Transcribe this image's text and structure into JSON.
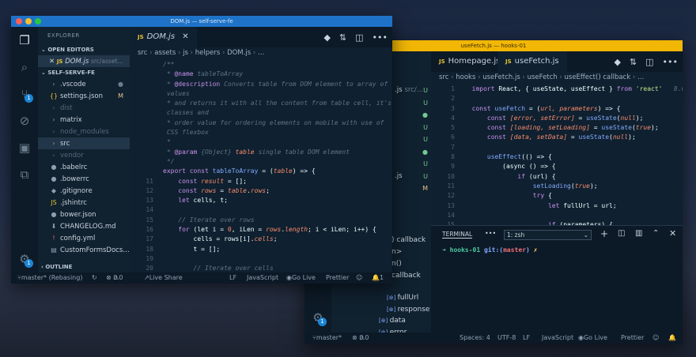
{
  "window_front": {
    "title": "DOM.js — self-serve-fe",
    "explorer_title": "EXPLORER",
    "open_editors_label": "OPEN EDITORS",
    "open_editor_file": "DOM.js",
    "open_editor_path": "src/asset…",
    "project_label": "SELF-SERVE-FE",
    "outline_label": "OUTLINE",
    "files": [
      {
        "name": ".vscode",
        "icon": "›",
        "status": "●",
        "color": "#c8d3dd"
      },
      {
        "name": "settings.json",
        "icon": "{}",
        "status": "M",
        "color": "#c8d3dd"
      },
      {
        "name": "dist",
        "icon": "›",
        "status": "",
        "color": "dim"
      },
      {
        "name": "matrix",
        "icon": "›",
        "status": "",
        "color": "#c8d3dd"
      },
      {
        "name": "node_modules",
        "icon": "›",
        "status": "",
        "color": "dim"
      },
      {
        "name": "src",
        "icon": "›",
        "status": "",
        "color": "#c8d3dd"
      },
      {
        "name": "vendor",
        "icon": "›",
        "status": "",
        "color": "dim"
      },
      {
        "name": ".babelrc",
        "icon": "●",
        "status": "",
        "color": "#c8d3dd"
      },
      {
        "name": ".bowerrc",
        "icon": "●",
        "status": "",
        "color": "#c8d3dd"
      },
      {
        "name": ".gitignore",
        "icon": "◆",
        "status": "",
        "color": "#c8d3dd"
      },
      {
        "name": ".jshintrc",
        "icon": "JS",
        "status": "",
        "color": "#c8d3dd"
      },
      {
        "name": "bower.json",
        "icon": "●",
        "status": "",
        "color": "#c8d3dd"
      },
      {
        "name": "CHANGELOG.md",
        "icon": "⬇",
        "status": "",
        "color": "#c8d3dd"
      },
      {
        "name": "config.yml",
        "icon": "!",
        "status": "",
        "color": "#c8d3dd"
      },
      {
        "name": "CustomFormsDocs…",
        "icon": "▤",
        "status": "",
        "color": "#c8d3dd"
      }
    ],
    "tab_label": "DOM.js",
    "breadcrumb": [
      "src",
      "assets",
      "js",
      "helpers",
      "DOM.js",
      "…"
    ],
    "code_lines": [
      {
        "n": "",
        "t": [
          [
            "/**",
            "c-cm"
          ]
        ]
      },
      {
        "n": "",
        "t": [
          [
            " * ",
            "c-cm"
          ],
          [
            "@name",
            "c-kw"
          ],
          [
            " tableToArray",
            "c-cm"
          ]
        ]
      },
      {
        "n": "",
        "t": [
          [
            " * ",
            "c-cm"
          ],
          [
            "@description",
            "c-kw"
          ],
          [
            " Converts table from DOM element to array of",
            "c-cm"
          ]
        ]
      },
      {
        "n": "",
        "t": [
          [
            " values",
            "c-cm"
          ]
        ]
      },
      {
        "n": "",
        "t": [
          [
            " * and returns it with all the content from table cell, it's",
            "c-cm"
          ]
        ]
      },
      {
        "n": "",
        "t": [
          [
            " classes and",
            "c-cm"
          ]
        ]
      },
      {
        "n": "",
        "t": [
          [
            " * order value for ordering elements on mobile with use of",
            "c-cm"
          ]
        ]
      },
      {
        "n": "",
        "t": [
          [
            " CSS flexbox",
            "c-cm"
          ]
        ]
      },
      {
        "n": "",
        "t": [
          [
            " *",
            "c-cm"
          ]
        ]
      },
      {
        "n": "",
        "t": [
          [
            " * ",
            "c-cm"
          ],
          [
            "@param",
            "c-kw"
          ],
          [
            " {Object} ",
            "c-cm"
          ],
          [
            "table",
            "c-it"
          ],
          [
            " single table DOM element",
            "c-cm"
          ]
        ]
      },
      {
        "n": "",
        "t": [
          [
            " */",
            "c-cm"
          ]
        ]
      },
      {
        "n": "",
        "t": [
          [
            "export const ",
            "c-kw"
          ],
          [
            "tableToArray",
            "c-fn"
          ],
          [
            " = (",
            "c-var"
          ],
          [
            "table",
            "c-it"
          ],
          [
            ") => {",
            "c-var"
          ]
        ]
      },
      {
        "n": "11",
        "t": [
          [
            "    const ",
            "c-kw"
          ],
          [
            "result",
            "c-it"
          ],
          [
            " = [];",
            "c-var"
          ]
        ]
      },
      {
        "n": "12",
        "t": [
          [
            "    const ",
            "c-kw"
          ],
          [
            "rows",
            "c-it"
          ],
          [
            " = ",
            "c-var"
          ],
          [
            "table",
            "c-it"
          ],
          [
            ".",
            "c-var"
          ],
          [
            "rows",
            "c-it"
          ],
          [
            ";",
            "c-var"
          ]
        ]
      },
      {
        "n": "13",
        "t": [
          [
            "    let ",
            "c-kw"
          ],
          [
            "cells, t;",
            "c-var"
          ]
        ]
      },
      {
        "n": "14",
        "t": [
          [
            "",
            "c-var"
          ]
        ]
      },
      {
        "n": "15",
        "t": [
          [
            "    // Iterate over rows",
            "c-cm"
          ]
        ]
      },
      {
        "n": "16",
        "t": [
          [
            "    for ",
            "c-kw"
          ],
          [
            "(let i = ",
            "c-var"
          ],
          [
            "0",
            "c-num"
          ],
          [
            ", iLen = ",
            "c-var"
          ],
          [
            "rows",
            "c-it"
          ],
          [
            ".",
            "c-var"
          ],
          [
            "length",
            "c-it"
          ],
          [
            "; i < iLen; i++) {",
            "c-var"
          ]
        ]
      },
      {
        "n": "17",
        "t": [
          [
            "        cells = rows[i].",
            "c-var"
          ],
          [
            "cells",
            "c-it"
          ],
          [
            ";",
            "c-var"
          ]
        ]
      },
      {
        "n": "18",
        "t": [
          [
            "        t = [];",
            "c-var"
          ]
        ]
      },
      {
        "n": "19",
        "t": [
          [
            "",
            "c-var"
          ]
        ]
      },
      {
        "n": "20",
        "t": [
          [
            "        // Iterate over cells",
            "c-cm"
          ]
        ]
      }
    ],
    "status": {
      "branch": "master* (Rebasing)",
      "errors": "0",
      "warnings": "0",
      "live_share": "Live Share",
      "eol": "LF",
      "lang": "JavaScript",
      "go_live": "Go Live",
      "prettier": "Prettier",
      "bell": "1"
    }
  },
  "window_back": {
    "title": "useFetch.js — hooks-01",
    "tabs": [
      "Homepage.js",
      "useFetch.js"
    ],
    "breadcrumb": [
      "src",
      "hooks",
      "useFetch.js",
      "useFetch",
      "useEffect() callback",
      "…"
    ],
    "sidebar_partial": [
      {
        "name": ".js",
        "path": "src/...",
        "status": "U"
      },
      {
        "name": "",
        "path": "",
        "status": "U"
      },
      {
        "name": "",
        "path": "",
        "status": "●"
      },
      {
        "name": "",
        "path": "",
        "status": "U"
      },
      {
        "name": "",
        "path": "",
        "status": "U"
      },
      {
        "name": "",
        "path": "",
        "status": "●"
      },
      {
        "name": "",
        "path": "",
        "status": "U"
      },
      {
        "name": ".js",
        "path": "",
        "status": "U"
      },
      {
        "name": "",
        "path": "",
        "status": "M"
      }
    ],
    "outline_partial": [
      ") callback",
      "n>",
      "n() callback"
    ],
    "outline_items": [
      "fullUrl",
      "response",
      "data",
      "error"
    ],
    "code_lines": [
      {
        "n": "1",
        "t": [
          [
            "  import ",
            "c-kw"
          ],
          [
            "React, { useState, useEffect } ",
            "c-var"
          ],
          [
            "from ",
            "c-kw"
          ],
          [
            "'react'",
            "c-str"
          ],
          [
            "   8.6K (gz",
            "c-cm"
          ]
        ]
      },
      {
        "n": "2",
        "t": [
          [
            "",
            "c-var"
          ]
        ]
      },
      {
        "n": "3",
        "t": [
          [
            "  const ",
            "c-kw"
          ],
          [
            "useFetch",
            "c-fn"
          ],
          [
            " = (",
            "c-var"
          ],
          [
            "url, parameters",
            "c-it"
          ],
          [
            ") => {",
            "c-var"
          ]
        ]
      },
      {
        "n": "4",
        "t": [
          [
            "      const ",
            "c-kw"
          ],
          [
            "[error, setError]",
            "c-it"
          ],
          [
            " = ",
            "c-var"
          ],
          [
            "useState",
            "c-fn"
          ],
          [
            "(",
            "c-var"
          ],
          [
            "null",
            "c-it"
          ],
          [
            ");",
            "c-var"
          ]
        ]
      },
      {
        "n": "5",
        "t": [
          [
            "      const ",
            "c-kw"
          ],
          [
            "[loading, setLoading]",
            "c-it"
          ],
          [
            " = ",
            "c-var"
          ],
          [
            "useState",
            "c-fn"
          ],
          [
            "(",
            "c-var"
          ],
          [
            "true",
            "c-it"
          ],
          [
            ");",
            "c-var"
          ]
        ]
      },
      {
        "n": "6",
        "t": [
          [
            "      const ",
            "c-kw"
          ],
          [
            "[data, setData]",
            "c-it"
          ],
          [
            " = ",
            "c-var"
          ],
          [
            "useState",
            "c-fn"
          ],
          [
            "(",
            "c-var"
          ],
          [
            "null",
            "c-it"
          ],
          [
            ");",
            "c-var"
          ]
        ]
      },
      {
        "n": "7",
        "t": [
          [
            "",
            "c-var"
          ]
        ]
      },
      {
        "n": "8",
        "t": [
          [
            "      useEffect",
            "c-fn"
          ],
          [
            "(() => {",
            "c-var"
          ]
        ]
      },
      {
        "n": "9",
        "t": [
          [
            "          (async () => {",
            "c-var"
          ]
        ]
      },
      {
        "n": "10",
        "t": [
          [
            "              if ",
            "c-kw"
          ],
          [
            "(url) {",
            "c-var"
          ]
        ]
      },
      {
        "n": "11",
        "t": [
          [
            "                  setLoading",
            "c-fn"
          ],
          [
            "(",
            "c-var"
          ],
          [
            "true",
            "c-it"
          ],
          [
            ");",
            "c-var"
          ]
        ]
      },
      {
        "n": "12",
        "t": [
          [
            "                  try ",
            "c-kw"
          ],
          [
            "{",
            "c-var"
          ]
        ]
      },
      {
        "n": "13",
        "t": [
          [
            "                      let ",
            "c-kw"
          ],
          [
            "fullUrl = url;",
            "c-var"
          ]
        ]
      },
      {
        "n": "14",
        "t": [
          [
            "",
            "c-var"
          ]
        ]
      },
      {
        "n": "15",
        "t": [
          [
            "                      if ",
            "c-kw"
          ],
          [
            "(parameters) {",
            "c-var"
          ]
        ]
      }
    ],
    "terminal": {
      "label": "TERMINAL",
      "more": "•••",
      "shell": "1: zsh",
      "prompt_arrow": "➜",
      "prompt_dir": "hooks-01",
      "prompt_git": "git:(",
      "prompt_branch": "master",
      "prompt_close": ")",
      "prompt_x": "✗"
    },
    "status": {
      "branch": "master*",
      "errors": "0",
      "warnings": "0",
      "spaces": "Spaces: 4",
      "encoding": "UTF-8",
      "eol": "LF",
      "lang": "JavaScript",
      "go_live": "Go Live",
      "prettier": "Prettier"
    }
  }
}
